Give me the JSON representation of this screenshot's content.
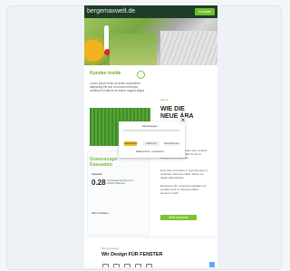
{
  "header": {
    "brand": "bergemaxwelt.de",
    "button": "Kontakt"
  },
  "hero": {
    "title": "Kunden inside",
    "intro": "Lorem ipsum dolor sit amet consectetur adipiscing elit sed do eiusmod tempor incididunt ut labore et dolore magna aliqua."
  },
  "right": {
    "label": "Saison",
    "headline": "WIE DIE NEUE ÄRA",
    "paragraph1": "Ut enim ad minim veniam quis nostrud exercitation ullamco laboris nisi ut aliquip ex ea commodo.",
    "paragraph2": "Duis aute irure dolor in reprehenderit in voluptate velit esse cillum dolore eu fugiat nulla pariatur.",
    "paragraph3": "Excepteur sint occaecat cupidatat non proident sunt in culpa qui officia deserunt mollit.",
    "cta": "Jetzt ansehen"
  },
  "promo": {
    "title": "Greenscape Fassaden",
    "caption": "Fassade",
    "number": "0.28",
    "small": "Temperaturreduzierung in urbanen Räumen.",
    "link": "Mehr erfahren"
  },
  "modal": {
    "title": "Einstellungen",
    "buttons": [
      "Akzeptieren",
      "Ablehnen",
      "Einstellungen"
    ],
    "footer": "Datenschutz · Impressum"
  },
  "footer": {
    "eyebrow": "Ihre Lösungen",
    "headline": "Wir Design FÜR FENSTER",
    "icons": [
      "icon-1",
      "icon-2",
      "icon-3",
      "icon-4",
      "icon-5"
    ]
  },
  "colors": {
    "brand": "#1f3d26",
    "accent": "#7dc331",
    "warning": "#e6c31a"
  }
}
